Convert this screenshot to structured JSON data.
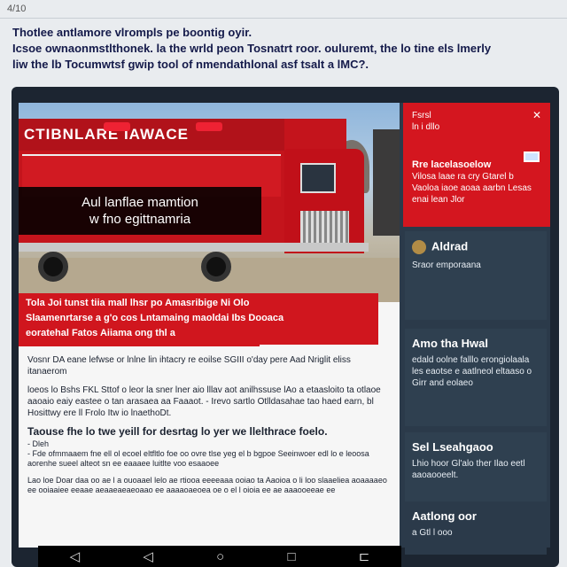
{
  "page_tag": "4/10",
  "intro": {
    "line1": "Thotlee antlamore vlrompls pe boontig oyir.",
    "line2": "Icsoe ownaonmstlthonek. la the wrld peon Tosnatrt roor. ouluremt, the lo tine els lmerly",
    "line3": "liw the lb Tocumwtsf gwip tool of nmendathlonal asf tsalt a lMC?."
  },
  "hero": {
    "truck_title": "CTIBNLARE     IAWACE",
    "caption_line1": "Aul lanflae mamtion",
    "caption_line2": "w fno egittnamria"
  },
  "alert": {
    "line1": "Tola          Joi tunst tiia mall  lhsr  po  Amasribige  Ni  Olo",
    "line2": "Slaamenrtarse a g'o cos  Lntamaing  maoldai  Ibs Dooaca",
    "line3": "eoratehal  Fatos Aiiama ong thl a"
  },
  "article": {
    "p1": "Vosnr DA eane lefwse or lnlne lin ihtacry re eoilse SGIII o'day pere Aad Nriglit eliss itanaerom",
    "p2": "loeos lo Bshs FKL Sttof o leor la sner lner aio lllav aot anilhssuse lAo a etaasloito ta otlaoe aaoaio eaiy eastee o tan arasaea aa Faaaot. - Irevo sartlo Otlldasahae tao haed earn, bl Hosittwy ere ll Frolo Itw io lnaethoDt.",
    "subhead": "Taouse fhe lo twe yeill for desrtag lo yer we llelthrace foelo.",
    "subhead2": "- Dleh",
    "p3": "- Fde ofmmaaem fne ell ol ecoel eltfltlo foe oo ovre tlse yeg el b bgpoe Seeinwoer edl lo e leoosa aorenhe sueel alteot sn ee eaaaee luitlte voo esaaoee",
    "p4": "Lao loe Doar daa oo ae l a ouoaael lelo ae rtiooa eeeeaaa ooiao ta Aaoioa o li loo slaaeliea aoaaaaeo ee ooiaaiee eeaae aeaaeaeaeoaao ee aaaaoaeoea oe o el l oioia ee ae aaaooeeae ee"
  },
  "sidebar": {
    "red": {
      "top1": "Fsrsl",
      "top2": "ln i dllo",
      "head": "Rre lacelasoelow",
      "body": "Vilosa laae ra cry Gtarel b Vaoloa iaoe aoaa aarbn Lesas enai lean Jlor"
    },
    "card1": {
      "title": "Aldrad",
      "body": "Sraor emporaana"
    },
    "card2": {
      "title": "Amo tha Hwal",
      "body": "edald oolne falllo erongiolaala les eaotse e aatlneol eltaaso o Girr and eolaeo"
    },
    "card3": {
      "title": "Sel Lseahgaoo",
      "body": "Lhio hoor Gl'alo ther Ilao eetl aaoaooeelt."
    },
    "card4": {
      "title": "Aatlong oor",
      "body": "a Gtl l ooo"
    }
  },
  "navbar": {
    "back_icon": "◁",
    "back2_icon": "◁",
    "home_icon": "○",
    "recent_icon": "□",
    "menu_icon": "⊏"
  }
}
